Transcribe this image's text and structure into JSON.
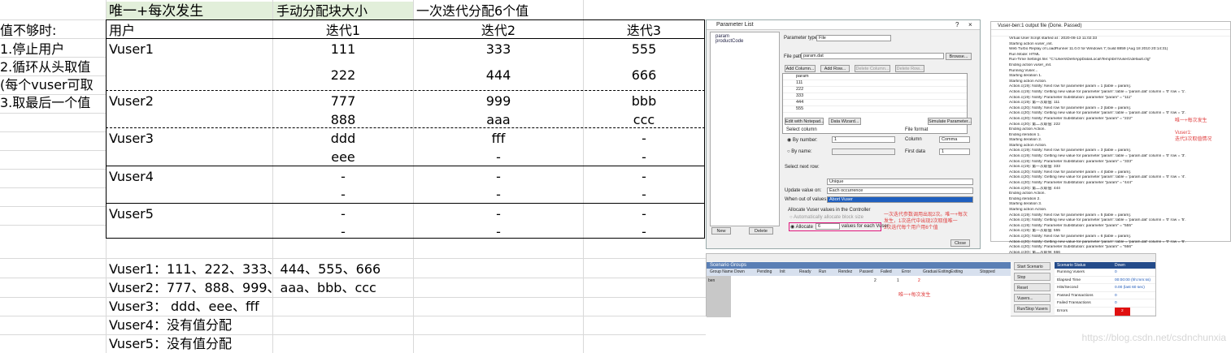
{
  "sheet": {
    "header": {
      "unique_each": "唯一+每次发生",
      "manual_block": "手动分配块大小",
      "six_values": "一次迭代分配6个值"
    },
    "side_notes": [
      "值不够时:",
      "1.停止用户",
      "2.循环从头取值",
      "(每个vuser可取",
      "3.取最后一个值"
    ],
    "columns": [
      "用户",
      "迭代1",
      "迭代2",
      "迭代3"
    ],
    "rows": [
      {
        "user": "Vuser1",
        "r1": [
          "111",
          "333",
          "555"
        ],
        "r2": [
          "222",
          "444",
          "666"
        ]
      },
      {
        "user": "Vuser2",
        "r1": [
          "777",
          "999",
          "bbb"
        ],
        "r2": [
          "888",
          "aaa",
          "ccc"
        ]
      },
      {
        "user": "Vuser3",
        "r1": [
          "ddd",
          "fff",
          "-"
        ],
        "r2": [
          "eee",
          "-",
          "-"
        ]
      },
      {
        "user": "Vuser4",
        "r1": [
          "-",
          "-",
          "-"
        ],
        "r2": [
          "-",
          "-",
          "-"
        ]
      },
      {
        "user": "Vuser5",
        "r1": [
          "-",
          "-",
          "-"
        ],
        "r2": [
          "-",
          "-",
          "-"
        ]
      }
    ],
    "summary": [
      "Vuser1：111、222、333、444、555、666",
      "Vuser2：777、888、999、aaa、bbb、ccc",
      "Vuser3： ddd、eee、fff",
      "Vuser4：没有值分配",
      "Vuser5：没有值分配"
    ]
  },
  "param_list": {
    "title": "Parameter List",
    "tree": [
      "param",
      "productCode"
    ],
    "param_type_label": "Parameter type:",
    "param_type_value": "File",
    "file_path_label": "File path:",
    "file_path_value": "param.dat",
    "browse": "Browse...",
    "add_column": "Add Column...",
    "add_row": "Add Row...",
    "delete_column": "Delete Column...",
    "delete_row": "Delete Row...",
    "data_rows": [
      "param",
      "111",
      "222",
      "333",
      "444",
      "555"
    ],
    "edit_notepad": "Edit with Notepad...",
    "data_wizard": "Data Wizard...",
    "simulate": "Simulate Parameter...",
    "select_column": "Select column",
    "by_number": "By number:",
    "by_number_value": "1",
    "by_name": "By name:",
    "file_format": "File format",
    "column_label": "Column",
    "column_value": "Comma",
    "first_data_label": "First data",
    "first_data_value": "1",
    "select_next_row": "Select next row:",
    "select_next_row_value": "Unique",
    "update_value_on": "Update value on:",
    "update_value_on_value": "Each occurrence",
    "when_out_of_values": "When out of values:",
    "when_out_of_values_value": "Abort Vuser",
    "allocate_group": "Allocate Vuser values in the Controller",
    "auto_allocate": "Automatically allocate block size",
    "allocate": "Allocate",
    "allocate_value": "6",
    "allocate_suffix": "values for each Vuser",
    "new": "New",
    "delete": "Delete",
    "close": "Close",
    "annotation": [
      "一次迭代参数调用出现2次。唯一+每次",
      "发生，1次迭代中出现2次取值唯一",
      "3次迭代每个用户用6个值"
    ]
  },
  "output": {
    "title": "Vuser-ben:1 output file (Done. Passed)",
    "lines": [
      "Virtual User Script started at : 2020-08-13 11:02:33",
      "Starting action vuser_init.",
      "Web Turbo Replay of LoadRunner 11.0.0 for Windows 7; build 8859 (Aug 18 2010 20:14:31)",
      "Run Mode: HTML",
      "Run-Time Settings file: \"C:\\Users\\Dell\\AppData\\Local\\Temp\\brr\\Vuser1\\default.cfg\"",
      "Ending action vuser_init.",
      "Running Vuser...",
      "Starting iteration 1.",
      "Starting action Action.",
      "Action.c(19): Notify: Next row for parameter param = 1 [table = param].",
      "Action.c(19): Notify: Getting new value for parameter 'param': table = 'param.dat' column = '0' row = '1'.",
      "Action.c(19): Notify: Parameter Substitution: parameter \"param\" = \"111\"",
      "Action.c(19): 第一次取值: 111",
      "Action.c(20): Notify: Next row for parameter param = 2 [table = param].",
      "Action.c(20): Notify: Getting new value for parameter 'param': table = 'param.dat' column = '0' row = '2'.",
      "Action.c(20): Notify: Parameter Substitution: parameter \"param\" = \"222\"",
      "Action.c(20): 第二次取值: 222",
      "Ending action Action.",
      "Ending iteration 1.",
      "Starting iteration 2.",
      "Starting action Action.",
      "Action.c(19): Notify: Next row for parameter param = 3 [table = param].",
      "Action.c(19): Notify: Getting new value for parameter 'param': table = 'param.dat' column = '0' row = '3'.",
      "Action.c(19): Notify: Parameter Substitution: parameter \"param\" = \"333\"",
      "Action.c(19): 第一次取值: 333",
      "Action.c(20): Notify: Next row for parameter param = 4 [table = param].",
      "Action.c(20): Notify: Getting new value for parameter 'param': table = 'param.dat' column = '0' row = '4'.",
      "Action.c(20): Notify: Parameter Substitution: parameter \"param\" = \"444\"",
      "Action.c(20): 第二次取值: 444",
      "Ending action Action.",
      "Ending iteration 2.",
      "Starting iteration 3.",
      "Starting action Action.",
      "Action.c(19): Notify: Next row for parameter param = 5 [table = param].",
      "Action.c(19): Notify: Getting new value for parameter 'param': table = 'param.dat' column = '0' row = '5'.",
      "Action.c(19): Notify: Parameter Substitution: parameter \"param\" = \"555\"",
      "Action.c(19): 第一次取值: 555",
      "Action.c(20): Notify: Next row for parameter param = 6 [table = param].",
      "Action.c(20): Notify: Getting new value for parameter 'param': table = 'param.dat' column = '0' row = '6'.",
      "Action.c(20): Notify: Parameter Substitution: parameter \"param\" = \"666\"",
      "Action.c(20): 第二次取值: 666",
      "Ending action Action."
    ],
    "note1": "唯一+每次发生",
    "note2a": "Vuser1:",
    "note2b": "迭代3次取值情况"
  },
  "controller": {
    "groups_title": "Scenario Groups",
    "cols": [
      "Group Name",
      "Down",
      "Pending",
      "Init",
      "Ready",
      "Run",
      "Rendez",
      "Passed",
      "Failed",
      "Error",
      "Gradual Exiting",
      "Exiting",
      "Stopped"
    ],
    "counts": [
      "1",
      "0",
      "0",
      "0",
      "0",
      "0",
      "0",
      "0",
      "0",
      "0",
      "0",
      "0",
      "0"
    ],
    "row_name": "ben",
    "row_vals": [
      "2",
      "1",
      "2"
    ],
    "annotation": "唯一+每次发生",
    "buttons": [
      "Start Scenario",
      "Stop",
      "Reset",
      "Vusers...",
      "Run/Stop Vusers"
    ],
    "status_title": "Scenario Status",
    "status_state": "Down",
    "status": [
      {
        "label": "Running Vusers",
        "value": "0"
      },
      {
        "label": "Elapsed Time",
        "value": "00:00:00 (hh:mm:ss)"
      },
      {
        "label": "Hits/Second",
        "value": "0.00 (last 60 sec)"
      },
      {
        "label": "Passed Transactions",
        "value": "0"
      },
      {
        "label": "Failed Transactions",
        "value": "0"
      },
      {
        "label": "Errors",
        "value": "2"
      }
    ]
  },
  "watermark": "https://blog.csdn.net/csdnchunxia"
}
